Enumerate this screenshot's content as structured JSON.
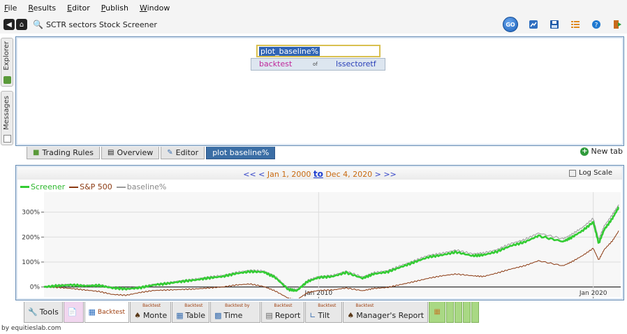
{
  "menu": {
    "items": [
      {
        "label": "File",
        "underline": "F",
        "rest": "ile"
      },
      {
        "label": "Results",
        "underline": "R",
        "rest": "esults"
      },
      {
        "label": "Editor",
        "underline": "E",
        "rest": "ditor"
      },
      {
        "label": "Publish",
        "underline": "P",
        "rest": "ublish"
      },
      {
        "label": "Window",
        "underline": "W",
        "rest": "indow"
      }
    ]
  },
  "toolbar": {
    "title": "SCTR sectors Stock Screener",
    "go_label": "GO",
    "icons": [
      "chart-icon",
      "save-icon",
      "list-icon",
      "help-icon",
      "exit-icon"
    ]
  },
  "side_tabs": {
    "explorer": "Explorer",
    "messages": "Messages"
  },
  "editor": {
    "input_value": "plot_baseline%",
    "rule_backtest": "backtest",
    "rule_of": "of",
    "rule_target": "lssectoretf"
  },
  "editor_tabs": [
    {
      "label": "Trading Rules",
      "icon": "rules-icon"
    },
    {
      "label": "Overview",
      "icon": "overview-icon"
    },
    {
      "label": "Editor",
      "icon": "editor-icon"
    },
    {
      "label": "plot baseline%",
      "icon": "",
      "active": true
    }
  ],
  "new_tab_label": "New tab",
  "chart_header": {
    "prev": "<< <",
    "start": "Jan 1, 2000",
    "to": "to",
    "end": "Dec 4, 2020",
    "next": "> >>",
    "log_scale": "Log Scale"
  },
  "chart_data": {
    "type": "line",
    "x_range": [
      "2000-01-01",
      "2020-12-04"
    ],
    "ylim": [
      -40,
      380
    ],
    "y_ticks": [
      "300%",
      "200%",
      "100%",
      "0%"
    ],
    "y_tick_values": [
      300,
      200,
      100,
      0
    ],
    "x_ticks": [
      "Jan 2010",
      "Jan 2020"
    ],
    "x_tick_years": [
      2010.0,
      2020.0
    ],
    "grid": true,
    "series": [
      {
        "name": "Screener",
        "color": "#33cc33",
        "points": [
          [
            2000.0,
            0
          ],
          [
            2000.5,
            5
          ],
          [
            2001.0,
            8
          ],
          [
            2001.5,
            4
          ],
          [
            2002.0,
            6
          ],
          [
            2002.5,
            -4
          ],
          [
            2003.0,
            -8
          ],
          [
            2003.5,
            -3
          ],
          [
            2004.0,
            8
          ],
          [
            2004.5,
            14
          ],
          [
            2005.0,
            22
          ],
          [
            2005.5,
            28
          ],
          [
            2006.0,
            36
          ],
          [
            2006.5,
            42
          ],
          [
            2007.0,
            54
          ],
          [
            2007.5,
            62
          ],
          [
            2008.0,
            60
          ],
          [
            2008.4,
            40
          ],
          [
            2008.9,
            -10
          ],
          [
            2009.2,
            -15
          ],
          [
            2009.6,
            22
          ],
          [
            2010.0,
            38
          ],
          [
            2010.5,
            42
          ],
          [
            2011.0,
            58
          ],
          [
            2011.6,
            35
          ],
          [
            2012.0,
            52
          ],
          [
            2012.5,
            60
          ],
          [
            2013.0,
            80
          ],
          [
            2013.5,
            100
          ],
          [
            2014.0,
            120
          ],
          [
            2014.5,
            128
          ],
          [
            2015.0,
            140
          ],
          [
            2015.6,
            125
          ],
          [
            2016.0,
            128
          ],
          [
            2016.5,
            142
          ],
          [
            2017.0,
            165
          ],
          [
            2017.5,
            180
          ],
          [
            2018.0,
            205
          ],
          [
            2018.9,
            182
          ],
          [
            2019.2,
            198
          ],
          [
            2019.6,
            225
          ],
          [
            2020.0,
            260
          ],
          [
            2020.2,
            175
          ],
          [
            2020.4,
            230
          ],
          [
            2020.7,
            275
          ],
          [
            2020.93,
            320
          ]
        ]
      },
      {
        "name": "S&P 500",
        "color": "#8b3a12",
        "points": [
          [
            2000.0,
            0
          ],
          [
            2000.5,
            -2
          ],
          [
            2001.0,
            -6
          ],
          [
            2001.5,
            -12
          ],
          [
            2002.0,
            -18
          ],
          [
            2002.5,
            -30
          ],
          [
            2003.0,
            -33
          ],
          [
            2003.5,
            -22
          ],
          [
            2004.0,
            -14
          ],
          [
            2004.5,
            -12
          ],
          [
            2005.0,
            -10
          ],
          [
            2005.5,
            -8
          ],
          [
            2006.0,
            -4
          ],
          [
            2006.5,
            0
          ],
          [
            2007.0,
            8
          ],
          [
            2007.5,
            12
          ],
          [
            2008.0,
            2
          ],
          [
            2008.4,
            -15
          ],
          [
            2008.9,
            -45
          ],
          [
            2009.2,
            -52
          ],
          [
            2009.6,
            -22
          ],
          [
            2010.0,
            -14
          ],
          [
            2010.5,
            -12
          ],
          [
            2011.0,
            -4
          ],
          [
            2011.6,
            -15
          ],
          [
            2012.0,
            -6
          ],
          [
            2012.5,
            -2
          ],
          [
            2013.0,
            10
          ],
          [
            2013.5,
            22
          ],
          [
            2014.0,
            35
          ],
          [
            2014.5,
            45
          ],
          [
            2015.0,
            52
          ],
          [
            2015.6,
            45
          ],
          [
            2016.0,
            42
          ],
          [
            2016.5,
            56
          ],
          [
            2017.0,
            72
          ],
          [
            2017.5,
            85
          ],
          [
            2018.0,
            105
          ],
          [
            2018.9,
            85
          ],
          [
            2019.2,
            100
          ],
          [
            2019.6,
            125
          ],
          [
            2020.0,
            155
          ],
          [
            2020.2,
            108
          ],
          [
            2020.4,
            150
          ],
          [
            2020.7,
            185
          ],
          [
            2020.93,
            225
          ]
        ]
      },
      {
        "name": "baseline%",
        "color": "#9a9a9a",
        "points": [
          [
            2000.0,
            0
          ],
          [
            2000.5,
            7
          ],
          [
            2001.0,
            10
          ],
          [
            2001.5,
            6
          ],
          [
            2002.0,
            8
          ],
          [
            2002.5,
            -2
          ],
          [
            2003.0,
            -6
          ],
          [
            2003.5,
            -1
          ],
          [
            2004.0,
            10
          ],
          [
            2004.5,
            16
          ],
          [
            2005.0,
            25
          ],
          [
            2005.5,
            31
          ],
          [
            2006.0,
            40
          ],
          [
            2006.5,
            46
          ],
          [
            2007.0,
            58
          ],
          [
            2007.5,
            67
          ],
          [
            2008.0,
            64
          ],
          [
            2008.4,
            44
          ],
          [
            2008.9,
            -6
          ],
          [
            2009.2,
            -11
          ],
          [
            2009.6,
            26
          ],
          [
            2010.0,
            42
          ],
          [
            2010.5,
            46
          ],
          [
            2011.0,
            63
          ],
          [
            2011.6,
            40
          ],
          [
            2012.0,
            57
          ],
          [
            2012.5,
            65
          ],
          [
            2013.0,
            86
          ],
          [
            2013.5,
            106
          ],
          [
            2014.0,
            127
          ],
          [
            2014.5,
            135
          ],
          [
            2015.0,
            148
          ],
          [
            2015.6,
            133
          ],
          [
            2016.0,
            136
          ],
          [
            2016.5,
            150
          ],
          [
            2017.0,
            174
          ],
          [
            2017.5,
            190
          ],
          [
            2018.0,
            216
          ],
          [
            2018.9,
            193
          ],
          [
            2019.2,
            210
          ],
          [
            2019.6,
            238
          ],
          [
            2020.0,
            275
          ],
          [
            2020.2,
            190
          ],
          [
            2020.4,
            245
          ],
          [
            2020.7,
            290
          ],
          [
            2020.93,
            330
          ]
        ]
      }
    ]
  },
  "bottom_tabs": [
    {
      "small": "",
      "label": "Tools",
      "icon": "wrench-icon"
    },
    {
      "small": "",
      "label": "",
      "icon": "document-icon"
    },
    {
      "small": "",
      "label": "Backtest",
      "icon": "backtest-icon",
      "active": true
    },
    {
      "small": "Backtest",
      "label": "Monte",
      "icon": "person-icon"
    },
    {
      "small": "Backtest",
      "label": "Table",
      "icon": "table-icon"
    },
    {
      "small": "Backtest by",
      "label": "Time",
      "icon": "time-chart-icon"
    },
    {
      "small": "Backtest",
      "label": "Report",
      "icon": "report-icon"
    },
    {
      "small": "Backtest",
      "label": "Tilt",
      "icon": "tilt-icon"
    },
    {
      "small": "Backtest",
      "label": "Manager's Report",
      "icon": "manager-icon"
    }
  ],
  "credit": "by equitieslab.com"
}
